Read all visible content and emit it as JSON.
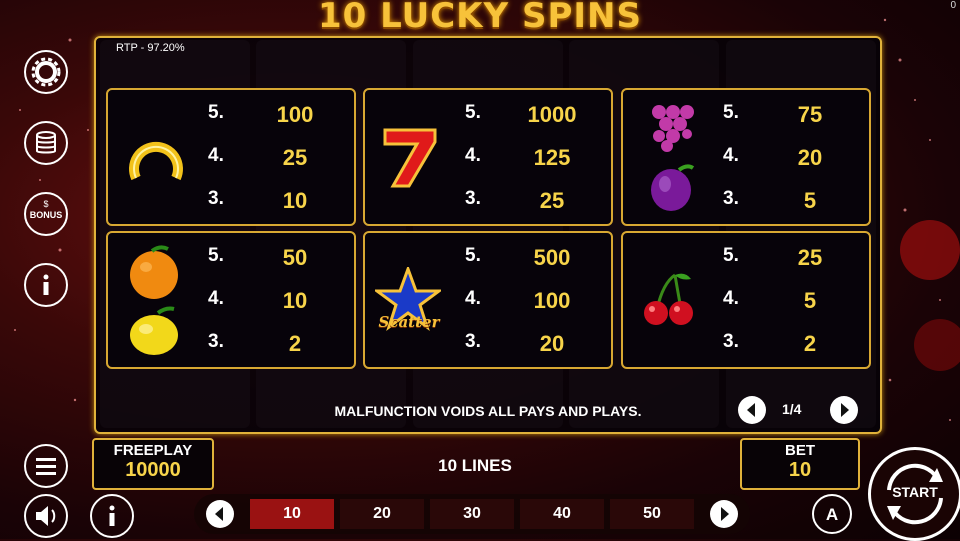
{
  "game": {
    "title": "10 LUCKY SPINS",
    "corner_value": "0",
    "rtp": "RTP - 97.20%"
  },
  "paytable": [
    {
      "symbol": "horseshoe",
      "pays": [
        {
          "k": "5.",
          "v": "100"
        },
        {
          "k": "4.",
          "v": "25"
        },
        {
          "k": "3.",
          "v": "10"
        }
      ]
    },
    {
      "symbol": "seven",
      "pays": [
        {
          "k": "5.",
          "v": "1000"
        },
        {
          "k": "4.",
          "v": "125"
        },
        {
          "k": "3.",
          "v": "25"
        }
      ]
    },
    {
      "symbol": "grapes-plum",
      "pays": [
        {
          "k": "5.",
          "v": "75"
        },
        {
          "k": "4.",
          "v": "20"
        },
        {
          "k": "3.",
          "v": "5"
        }
      ]
    },
    {
      "symbol": "orange-lemon",
      "pays": [
        {
          "k": "5.",
          "v": "50"
        },
        {
          "k": "4.",
          "v": "10"
        },
        {
          "k": "3.",
          "v": "2"
        }
      ]
    },
    {
      "symbol": "scatter-star",
      "label": "Scatter",
      "pays": [
        {
          "k": "5.",
          "v": "500"
        },
        {
          "k": "4.",
          "v": "100"
        },
        {
          "k": "3.",
          "v": "20"
        }
      ]
    },
    {
      "symbol": "cherries",
      "pays": [
        {
          "k": "5.",
          "v": "25"
        },
        {
          "k": "4.",
          "v": "5"
        },
        {
          "k": "3.",
          "v": "2"
        }
      ]
    }
  ],
  "notice": "MALFUNCTION VOIDS ALL PAYS AND PLAYS.",
  "pagination": {
    "text": "1/4"
  },
  "freeplay": {
    "label": "FREEPLAY",
    "value": "10000"
  },
  "lines": "10 LINES",
  "bet": {
    "label": "BET",
    "value": "10"
  },
  "bet_options": [
    "10",
    "20",
    "30",
    "40",
    "50"
  ],
  "selected_bet_index": 0,
  "start_label": "START",
  "side_icons": [
    "gear-icon",
    "coins-icon",
    "bonus-icon",
    "info-icon",
    "menu-icon",
    "sound-icon",
    "info-icon",
    "autoplay-icon"
  ],
  "colors": {
    "gold": "#e0b23a",
    "value": "#f7d44a",
    "selected": "#9a1212"
  }
}
